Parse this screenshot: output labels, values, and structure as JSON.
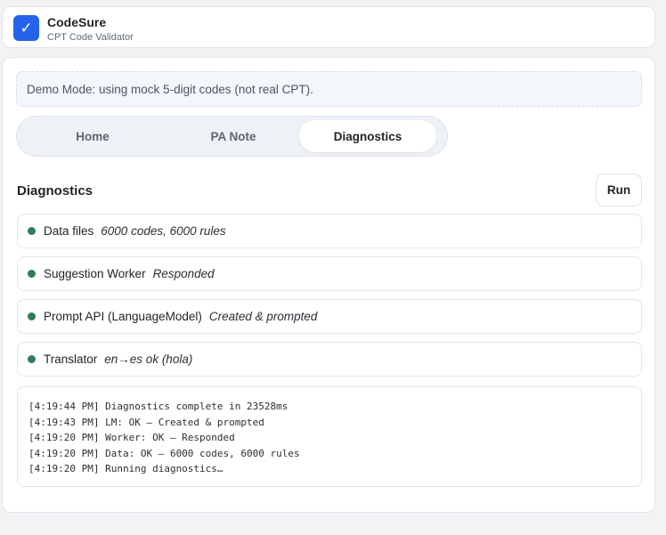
{
  "app": {
    "logo_glyph": "✓",
    "title": "CodeSure",
    "subtitle": "CPT Code Validator",
    "accent_color": "#2563eb"
  },
  "banner": {
    "text": "Demo Mode: using mock 5-digit codes (not real CPT)."
  },
  "tabs": [
    {
      "label": "Home",
      "active": false
    },
    {
      "label": "PA Note",
      "active": false
    },
    {
      "label": "Diagnostics",
      "active": true
    }
  ],
  "diagnostics": {
    "title": "Diagnostics",
    "run_label": "Run",
    "status_color": "#2f7d56",
    "checks": [
      {
        "name": "Data files",
        "detail": "6000 codes, 6000 rules"
      },
      {
        "name": "Suggestion Worker",
        "detail": "Responded"
      },
      {
        "name": "Prompt API (LanguageModel)",
        "detail": "Created & prompted"
      },
      {
        "name": "Translator",
        "detail": "en→es ok (hola)"
      }
    ],
    "log": [
      "[4:19:44 PM] Diagnostics complete in 23528ms",
      "[4:19:43 PM] LM: OK — Created & prompted",
      "[4:19:20 PM] Worker: OK — Responded",
      "[4:19:20 PM] Data: OK — 6000 codes, 6000 rules",
      "[4:19:20 PM] Running diagnostics…"
    ]
  }
}
